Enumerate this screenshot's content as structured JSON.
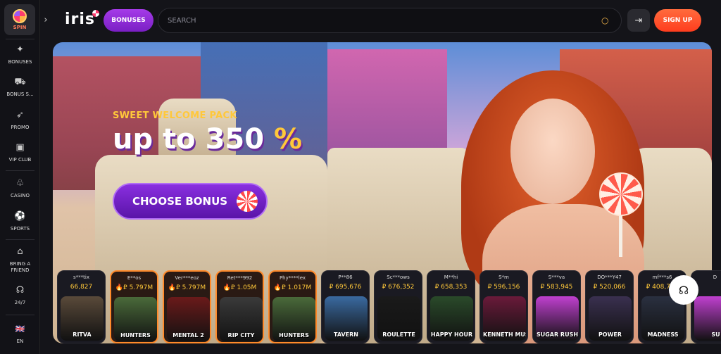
{
  "sidebar": {
    "spin_label": "SPIN",
    "items": [
      {
        "label": "BONUSES",
        "icon": "rocket-icon"
      },
      {
        "label": "BONUS S...",
        "icon": "cart-icon"
      },
      {
        "label": "PROMO",
        "icon": "rocket-icon"
      },
      {
        "label": "VIP CLUB",
        "icon": "crown-icon"
      },
      {
        "label": "CASINO",
        "icon": "cherry-icon"
      },
      {
        "label": "SPORTS",
        "icon": "ball-icon"
      },
      {
        "label": "BRING A FRIEND",
        "icon": "gift-icon"
      },
      {
        "label": "24/7",
        "icon": "headset-icon"
      },
      {
        "label": "EN",
        "icon": "flag-icon"
      }
    ]
  },
  "header": {
    "logo": "iris",
    "bonuses_label": "BONUSES",
    "search_placeholder": "SEARCH",
    "signup_label": "SIGN UP"
  },
  "banner": {
    "subtitle": "SWEET WELCOME PACK",
    "headline": "up to 350",
    "percent": "%",
    "cta_label": "CHOOSE BONUS"
  },
  "games": [
    {
      "user": "s***tix",
      "amount": "66,827",
      "name": "RITVA",
      "thumb": "#5a4a3a",
      "hot": false
    },
    {
      "user": "E**os",
      "amount": "🔥₽ 5.797M",
      "name": "HUNTERS",
      "thumb": "#4a6a3a",
      "hot": true
    },
    {
      "user": "Ver***eoz",
      "amount": "🔥₽ 5.797M",
      "name": "MENTAL 2",
      "thumb": "#6a1a1a",
      "hot": true
    },
    {
      "user": "Ret***992",
      "amount": "🔥₽ 1.05M",
      "name": "RIP CITY",
      "thumb": "#3a3a3a",
      "hot": true
    },
    {
      "user": "Phy****lex",
      "amount": "🔥₽ 1.017M",
      "name": "HUNTERS",
      "thumb": "#4a6a3a",
      "hot": true
    },
    {
      "user": "P**86",
      "amount": "₽ 695,676",
      "name": "TAVERN",
      "thumb": "#3a6aa0",
      "hot": false
    },
    {
      "user": "Sc***ows",
      "amount": "₽ 676,352",
      "name": "ROULETTE",
      "thumb": "#1a1a1a",
      "hot": false
    },
    {
      "user": "M**hi",
      "amount": "₽ 658,353",
      "name": "HAPPY HOUR",
      "thumb": "#2a4a2a",
      "hot": false
    },
    {
      "user": "S*m",
      "amount": "₽ 596,156",
      "name": "KENNETH MUST DIE",
      "thumb": "#6a1a3a",
      "hot": false
    },
    {
      "user": "S***va",
      "amount": "₽ 583,945",
      "name": "SUGAR RUSH",
      "thumb": "#c040d0",
      "hot": false
    },
    {
      "user": "DO***Y47",
      "amount": "₽ 520,066",
      "name": "POWER",
      "thumb": "#3a3050",
      "hot": false
    },
    {
      "user": "mf***s6",
      "amount": "₽ 408,710",
      "name": "MADNESS",
      "thumb": "#2a3040",
      "hot": false
    },
    {
      "user": "D",
      "amount": "",
      "name": "SU",
      "thumb": "#c040d0",
      "hot": false
    }
  ]
}
